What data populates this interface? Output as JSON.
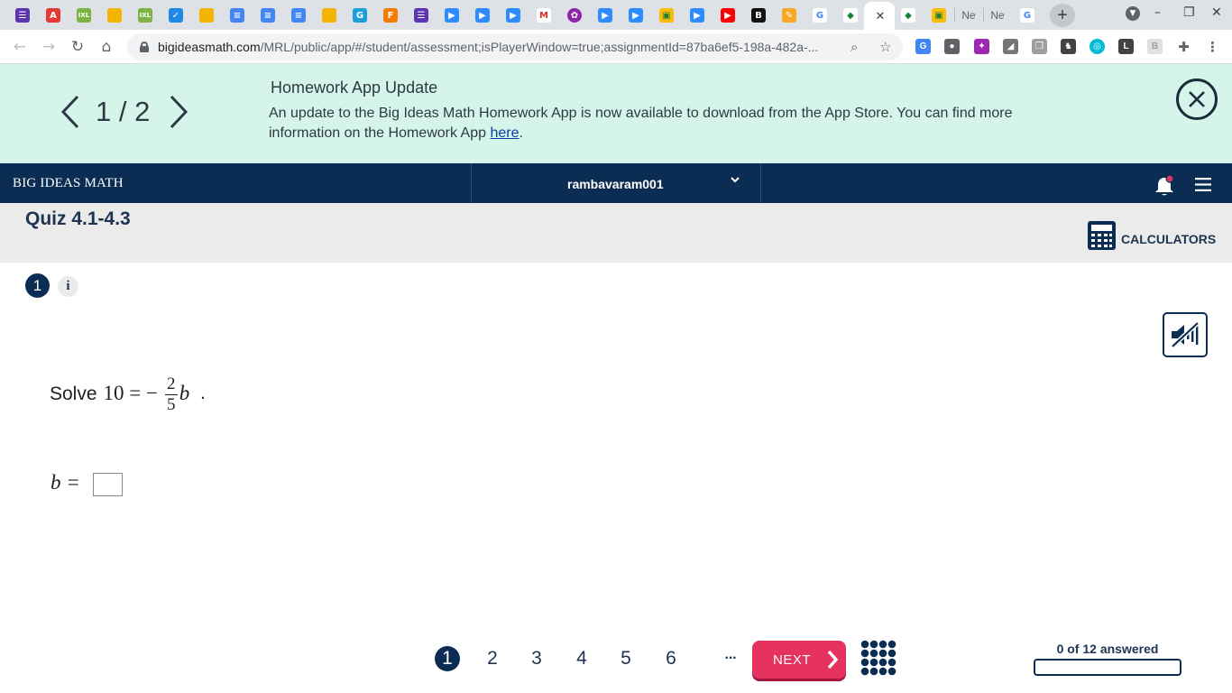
{
  "browser": {
    "tab_labels": [
      "Ne",
      "Ne"
    ],
    "url_host": "bigideasmath.com",
    "url_path": "/MRL/public/app/#/student/assessment;isPlayerWindow=true;assignmentId=87ba6ef5-198a-482a-..."
  },
  "banner": {
    "pager": "1 / 2",
    "title": "Homework App Update",
    "body": "An update to the Big Ideas Math Homework App is now available to download from the App Store. You can find more information on the Homework App ",
    "link_text": "here",
    "body_end": "."
  },
  "header": {
    "brand": "BIG IDEAS MATH",
    "username": "rambavaram001"
  },
  "quiz": {
    "title": "Quiz 4.1-4.3",
    "calculators_label": "CALCULATORS"
  },
  "question": {
    "number": "1",
    "info_glyph": "i",
    "prompt_word": "Solve",
    "equation_left": "10 = −",
    "fraction_num": "2",
    "fraction_den": "5",
    "variable": "b",
    "equation_end": ".",
    "answer_label": "b ="
  },
  "footer": {
    "question_numbers": [
      "1",
      "2",
      "3",
      "4",
      "5",
      "6"
    ],
    "ellipsis": "···",
    "next_label": "NEXT",
    "progress_text": "0 of 12 answered",
    "progress_fraction": 0
  },
  "colors": {
    "navy": "#0c2d53",
    "banner_bg": "#d6f5ea",
    "next_red": "#e5325e"
  }
}
